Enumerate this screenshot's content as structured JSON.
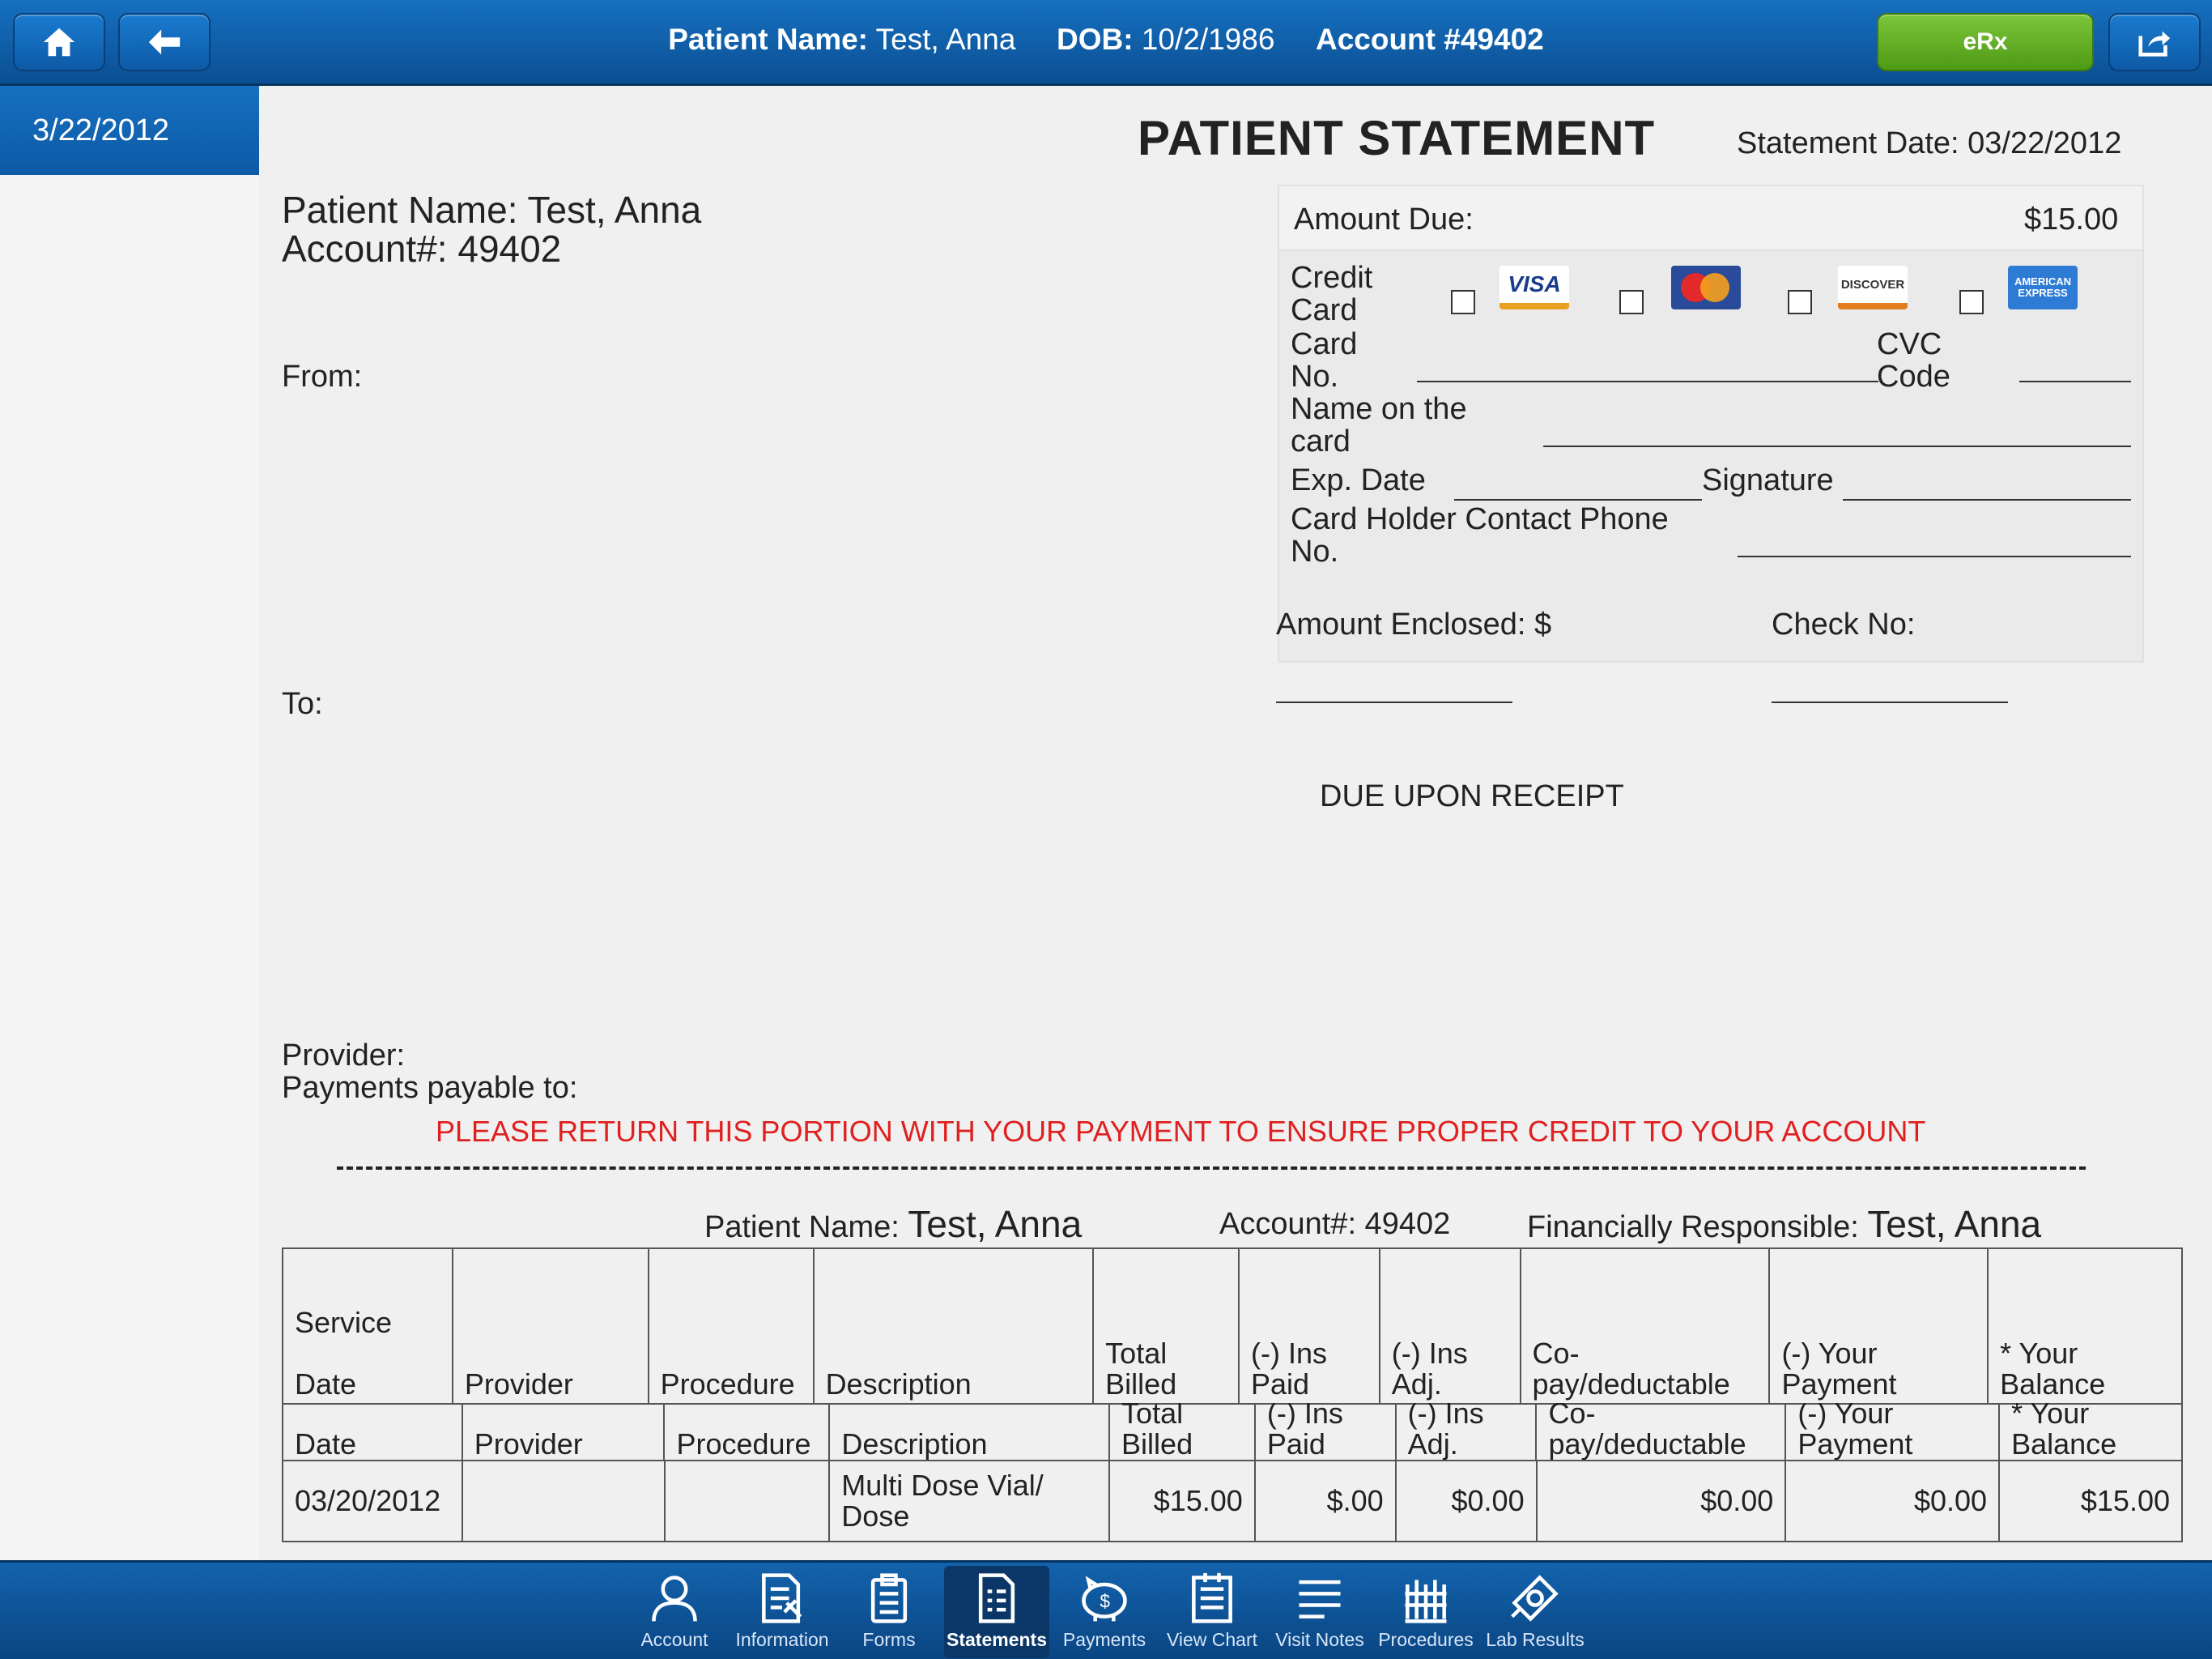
{
  "header": {
    "patient_name_label": "Patient Name:",
    "patient_name": "Test, Anna",
    "dob_label": "DOB:",
    "dob": "10/2/1986",
    "account_label": "Account #49402",
    "erx_label": "eRx"
  },
  "sidebar": {
    "selected_date": "3/22/2012"
  },
  "statement": {
    "title": "PATIENT STATEMENT",
    "statement_date": "Statement Date: 03/22/2012",
    "patient_name_label": "Patient Name:",
    "patient_name": "Test, Anna",
    "account": "Account#: 49402",
    "from_label": "From:",
    "to_label": "To:",
    "provider_label": "Provider:",
    "payable_label": "Payments payable to:",
    "return_note": "PLEASE RETURN THIS PORTION WITH YOUR PAYMENT TO ENSURE PROPER CREDIT TO YOUR ACCOUNT"
  },
  "payment_box": {
    "amount_due_label": "Amount Due:",
    "amount_due": "$15.00",
    "credit_card_label_1": "Credit",
    "credit_card_label_2": "Card",
    "card_no_label_1": "Card",
    "card_no_label_2": "No.",
    "cvc_label_1": "CVC",
    "cvc_label_2": "Code",
    "name_on_card_1": "Name on the",
    "name_on_card_2": "card",
    "exp_date_label": "Exp. Date",
    "signature_label": "Signature",
    "phone_label_1": "Card Holder Contact Phone",
    "phone_label_2": "No.",
    "card_visa": "VISA",
    "card_discover": "DISCOVER",
    "card_amex": "AMERICAN EXPRESS"
  },
  "remit": {
    "amount_enclosed_label": "Amount Enclosed: $",
    "check_no_label": "Check No:",
    "due_note": "DUE UPON RECEIPT"
  },
  "ledger": {
    "patient_name_label": "Patient Name:",
    "patient_name": "Test, Anna",
    "account": "Account#: 49402",
    "responsible_label": "Financially Responsible:",
    "responsible_name": "Test, Anna",
    "headers": {
      "service_date_1": "Service",
      "service_date_2": "Date",
      "provider": "Provider",
      "procedure": "Procedure",
      "description": "Description",
      "total_billed_1": "Total",
      "total_billed_2": "Billed",
      "ins_paid_1": "(-) Ins",
      "ins_paid_2": "Paid",
      "ins_adj_1": "(-) Ins",
      "ins_adj_2": "Adj.",
      "copay_1": "Co-",
      "copay_2": "pay/deductable",
      "your_payment_1": "(-) Your",
      "your_payment_2": "Payment",
      "your_balance_1": "* Your",
      "your_balance_2": "Balance"
    },
    "rows": [
      {
        "date": "03/20/2012",
        "provider": "",
        "procedure": "",
        "description_1": "Multi Dose Vial/",
        "description_2": "Dose",
        "total_billed": "$15.00",
        "ins_paid": "$.00",
        "ins_adj": "$0.00",
        "copay": "$0.00",
        "your_payment": "$0.00",
        "your_balance": "$15.00"
      }
    ]
  },
  "bottom_nav": {
    "items": [
      {
        "label": "Account",
        "icon": "person-icon"
      },
      {
        "label": "Information",
        "icon": "information-icon"
      },
      {
        "label": "Forms",
        "icon": "clipboard-icon"
      },
      {
        "label": "Statements",
        "icon": "statement-icon"
      },
      {
        "label": "Payments",
        "icon": "piggy-bank-icon"
      },
      {
        "label": "View Chart",
        "icon": "chart-icon"
      },
      {
        "label": "Visit Notes",
        "icon": "notes-icon"
      },
      {
        "label": "Procedures",
        "icon": "procedures-icon"
      },
      {
        "label": "Lab Results",
        "icon": "lab-icon"
      }
    ],
    "active": "Statements"
  },
  "colors": {
    "header_blue": "#0b4f93",
    "erx_green": "#5aa51c",
    "alert_red": "#e02020"
  }
}
